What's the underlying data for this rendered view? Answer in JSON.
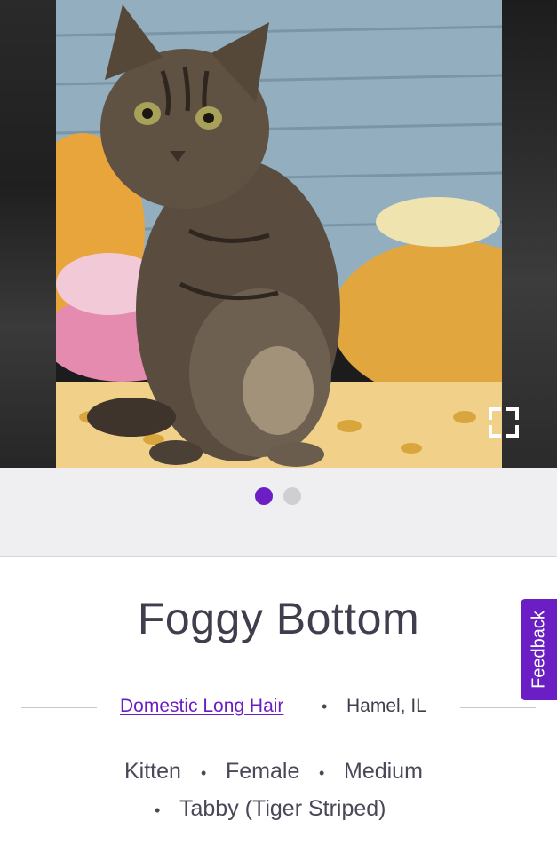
{
  "pet": {
    "name": "Foggy Bottom",
    "breed": "Domestic Long Hair",
    "location": "Hamel, IL",
    "age": "Kitten",
    "gender": "Female",
    "size": "Medium",
    "coat": "Tabby (Tiger Striped)"
  },
  "carousel": {
    "photo_count": 2,
    "current_index": 1,
    "expand_icon": "expand-icon"
  },
  "separator": "•",
  "feedback": {
    "label": "Feedback"
  },
  "colors": {
    "accent": "#6b1ec3",
    "text": "#403d4c",
    "dot_inactive": "#cfcfd3",
    "band_background": "#efeff1"
  }
}
